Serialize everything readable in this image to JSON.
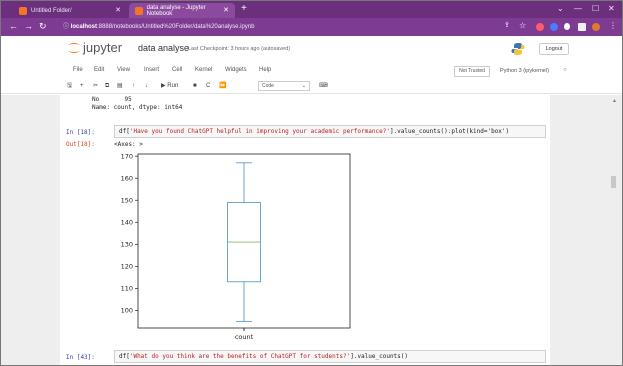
{
  "browser": {
    "tabs": [
      {
        "label": "Untitled Folder/",
        "active": false
      },
      {
        "label": "data analyse - Jupyter Notebook",
        "active": true
      }
    ],
    "url_host": "localhost",
    "url_rest": ":8888/notebooks/Untitled%20Folder/data%20analyse.ipynb"
  },
  "jupyter": {
    "brand": "jupyter",
    "notebook_title": "data analyse",
    "checkpoint": "Last Checkpoint: 3 hours ago  (autosaved)",
    "logout_label": "Logout",
    "menus": [
      "File",
      "Edit",
      "View",
      "Insert",
      "Cell",
      "Kernel",
      "Widgets",
      "Help"
    ],
    "trusted_label": "Not Trusted",
    "kernel_label": "Python 3 (ipykernel)",
    "run_label": "Run",
    "cell_type": "Code"
  },
  "cells": {
    "prev_output": {
      "line1": "No       95",
      "line2": "Name: count, dtype: int64"
    },
    "cell1": {
      "prompt_in": "In [18]:",
      "code_prefix": "df[",
      "code_string": "'Have you found ChatGPT helpful in improving your academic performance?'",
      "code_suffix": "].value_counts().plot(kind='box')",
      "prompt_out": "Out[18]:",
      "output_repr": "<Axes: >"
    },
    "cell2": {
      "prompt_in": "In [43]:",
      "code_prefix": "df[",
      "code_string": "'What do you think are the benefits of ChatGPT for students?'",
      "code_suffix": "].value_counts()"
    }
  },
  "colors": {
    "browser_tab_strip": "#6b2f7e",
    "browser_nav": "#7d3b91",
    "box_color": "#5b9ec9",
    "median_color": "#7fbf5a",
    "prompt_in": "#303f9f",
    "prompt_out": "#d84315"
  },
  "chart_data": {
    "type": "box",
    "categories": [
      "count"
    ],
    "box": {
      "whisker_low": 95,
      "q1": 113,
      "median": 131,
      "q3": 149,
      "whisker_high": 167
    },
    "ylim": [
      92,
      171
    ],
    "yticks": [
      100,
      110,
      120,
      130,
      140,
      150,
      160,
      170
    ],
    "xlabel": "",
    "ylabel": "",
    "title": "",
    "grid": false
  }
}
